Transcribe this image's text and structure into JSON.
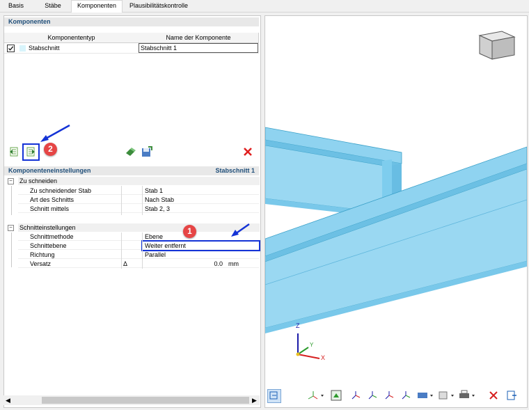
{
  "tabs": [
    {
      "label": "Basis"
    },
    {
      "label": "Stäbe"
    },
    {
      "label": "Komponenten"
    },
    {
      "label": "Plausibilitätskontrolle"
    }
  ],
  "components": {
    "title": "Komponenten",
    "col_type": "Komponententyp",
    "col_name": "Name der Komponente",
    "rows": [
      {
        "type": "Stabschnitt",
        "name": "Stabschnitt 1",
        "checked": true
      }
    ]
  },
  "settings": {
    "title": "Komponenteneinstellungen",
    "current": "Stabschnitt 1",
    "groups": [
      {
        "label": "Zu schneiden",
        "items": [
          {
            "label": "Zu schneidender Stab",
            "symbol": "",
            "value": "Stab 1",
            "unit": ""
          },
          {
            "label": "Art des Schnitts",
            "symbol": "",
            "value": "Nach Stab",
            "unit": ""
          },
          {
            "label": "Schnitt mittels",
            "symbol": "",
            "value": "Stab 2, 3",
            "unit": ""
          }
        ]
      },
      {
        "label": "Schnitteinstellungen",
        "items": [
          {
            "label": "Schnittmethode",
            "symbol": "",
            "value": "Ebene",
            "unit": ""
          },
          {
            "label": "Schnittebene",
            "symbol": "",
            "value": "Weiter entfernt",
            "unit": ""
          },
          {
            "label": "Richtung",
            "symbol": "",
            "value": "Parallel",
            "unit": ""
          },
          {
            "label": "Versatz",
            "symbol": "Δ",
            "value": "0.0",
            "unit": "mm"
          }
        ]
      }
    ]
  },
  "annotations": {
    "badge1": "1",
    "badge2": "2"
  },
  "axes": {
    "z": "Z",
    "y": "Y",
    "x": "X"
  },
  "colors": {
    "accent": "#1433d6",
    "badge": "#e64545",
    "beam": "#8fd3f0",
    "section_title": "#1f4e79"
  }
}
